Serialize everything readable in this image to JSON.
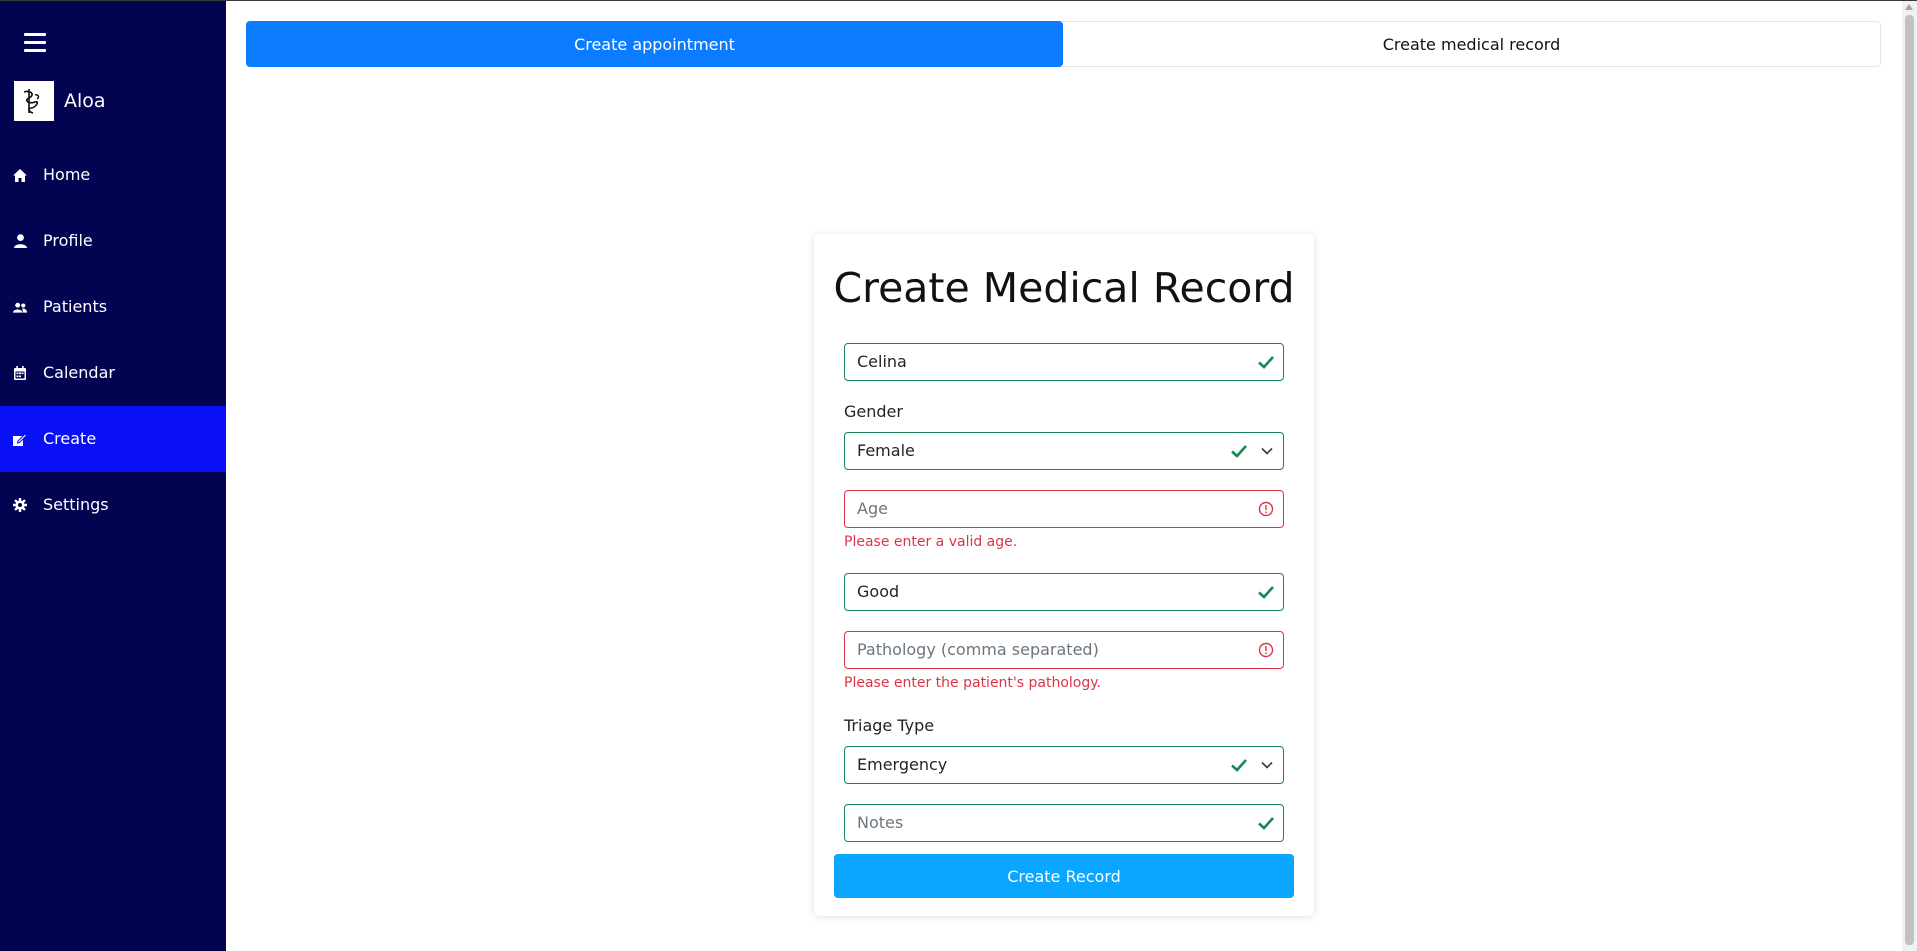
{
  "sidebar": {
    "brand": {
      "name": "Aloa",
      "logo_icon": "caduceus-icon"
    },
    "items": [
      {
        "label": "Home",
        "icon": "home-icon"
      },
      {
        "label": "Profile",
        "icon": "user-icon"
      },
      {
        "label": "Patients",
        "icon": "users-icon"
      },
      {
        "label": "Calendar",
        "icon": "calendar-icon"
      },
      {
        "label": "Create",
        "icon": "edit-icon",
        "active": true
      },
      {
        "label": "Settings",
        "icon": "gear-icon"
      }
    ]
  },
  "tabs": [
    {
      "label": "Create appointment",
      "active": true
    },
    {
      "label": "Create medical record",
      "active": false
    }
  ],
  "form": {
    "title": "Create Medical Record",
    "name": {
      "value": "Celina",
      "status": "valid"
    },
    "gender": {
      "label": "Gender",
      "selected": "Female",
      "status": "valid"
    },
    "age": {
      "placeholder": "Age",
      "value": "",
      "status": "invalid",
      "error": "Please enter a valid age."
    },
    "condition": {
      "value": "Good",
      "status": "valid"
    },
    "pathology": {
      "placeholder": "Pathology (comma separated)",
      "value": "",
      "status": "invalid",
      "error": "Please enter the patient's pathology."
    },
    "triage": {
      "label": "Triage Type",
      "selected": "Emergency",
      "status": "valid"
    },
    "notes": {
      "placeholder": "Notes",
      "value": "",
      "status": "valid"
    },
    "submit_label": "Create Record"
  },
  "colors": {
    "sidebar_bg": "#020452",
    "sidebar_active": "#0a10f5",
    "tab_active": "#0b7bff",
    "valid": "#198754",
    "invalid": "#dc3545",
    "submit": "#0aa6ff"
  }
}
